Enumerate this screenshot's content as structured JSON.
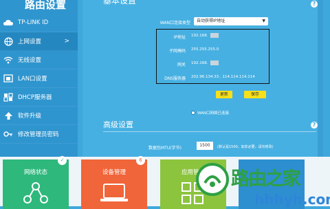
{
  "sidebar": {
    "brand": "路由设置",
    "items": [
      {
        "label": "TP-LINK ID",
        "icon": "cloud-icon"
      },
      {
        "label": "上网设置",
        "icon": "globe-icon",
        "active": true
      },
      {
        "label": "无线设置",
        "icon": "wifi-icon"
      },
      {
        "label": "LAN口设置",
        "icon": "lan-port-icon"
      },
      {
        "label": "DHCP服务器",
        "icon": "dhcp-icon"
      },
      {
        "label": "软件升级",
        "icon": "upgrade-arrow-icon"
      },
      {
        "label": "修改管理员密码",
        "icon": "key-icon"
      }
    ]
  },
  "basic": {
    "section_title": "基本设置",
    "wan_type_label": "WAN口连接类型",
    "wan_type_value": "自动获得IP地址",
    "ip_label": "IP地址",
    "ip_value": "192.168.",
    "mask_label": "子网掩码",
    "mask_value": "255.255.255.0",
    "gateway_label": "网关",
    "gateway_value": "192.168.",
    "dns_label": "DNS服务器",
    "dns_value": "202.96.134.33 , 114.114.114.114",
    "refresh_button": "更新",
    "save_button": "保存",
    "status_text": "WAN口网络已连接"
  },
  "advanced": {
    "section_title": "高级设置",
    "mtu_label": "数据包MTU(字节)",
    "mtu_value": "1500",
    "mtu_note": "(默认是1500，如非必要，请勿修改)",
    "help_text": "?"
  },
  "tiles": [
    {
      "label": "网络状态",
      "badge": "✓",
      "color": "#2eb87c",
      "badge_color": "#2eb87c"
    },
    {
      "label": "设备管理",
      "badge": "6",
      "color": "#f0653a",
      "badge_color": "#f0653a"
    },
    {
      "label": "应用管理",
      "badge": "",
      "color": "#8cc43e",
      "badge_color": "#8cc43e"
    }
  ],
  "watermark": {
    "text": "路由之家",
    "url": "hhhyh.com"
  },
  "colors": {
    "sidebar_bg": "#2f95cf",
    "main_bg": "#47b0e2",
    "button_yellow": "#f7e01a"
  }
}
